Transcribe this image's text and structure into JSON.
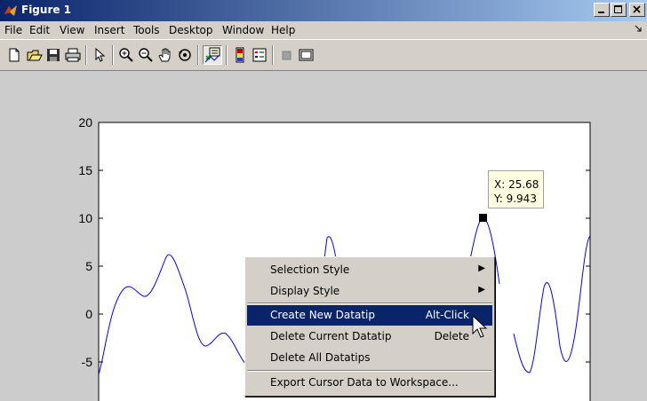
{
  "window": {
    "title": "Figure 1"
  },
  "menu": {
    "items": [
      "File",
      "Edit",
      "View",
      "Insert",
      "Tools",
      "Desktop",
      "Window",
      "Help"
    ]
  },
  "toolbar": {
    "buttons": [
      "new-figure",
      "open-file",
      "save",
      "print",
      "edit-plot",
      "zoom-in",
      "zoom-out",
      "pan",
      "rotate-3d",
      "data-cursor",
      "colorbar",
      "legend",
      "hide-plot-tools",
      "show-plot-tools"
    ],
    "pressed": "data-cursor"
  },
  "axes": {
    "yticks": [
      "20",
      "15",
      "10",
      "5",
      "0",
      "-5"
    ],
    "line_color": "#0000ff"
  },
  "datatip": {
    "x_label": "X: 25.68",
    "y_label": "Y: 9.943"
  },
  "context_menu": {
    "items": [
      {
        "label": "Selection Style",
        "shortcut": "",
        "submenu": true
      },
      {
        "label": "Display Style",
        "shortcut": "",
        "submenu": true
      },
      {
        "label": "Create New Datatip",
        "shortcut": "Alt-Click",
        "submenu": false,
        "highlighted": true
      },
      {
        "label": "Delete Current Datatip",
        "shortcut": "Delete",
        "submenu": false
      },
      {
        "label": "Delete All Datatips",
        "shortcut": "",
        "submenu": false
      },
      {
        "label": "Export Cursor Data to Workspace...",
        "shortcut": "",
        "submenu": false
      }
    ]
  }
}
